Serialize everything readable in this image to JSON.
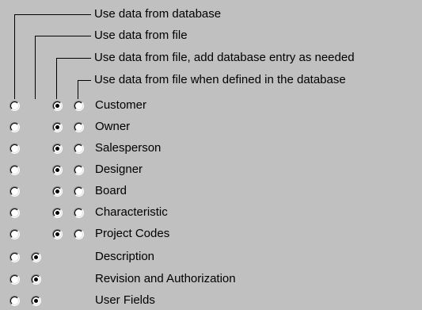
{
  "legend": [
    "Use data from database",
    "Use data from file",
    "Use data from file, add database entry as needed",
    "Use data from file when defined in the database"
  ],
  "rows": [
    {
      "label": "Customer",
      "options": [
        1,
        3,
        4
      ],
      "selected": 3
    },
    {
      "label": "Owner",
      "options": [
        1,
        3,
        4
      ],
      "selected": 3
    },
    {
      "label": "Salesperson",
      "options": [
        1,
        3,
        4
      ],
      "selected": 3
    },
    {
      "label": "Designer",
      "options": [
        1,
        3,
        4
      ],
      "selected": 3
    },
    {
      "label": "Board",
      "options": [
        1,
        3,
        4
      ],
      "selected": 3
    },
    {
      "label": "Characteristic",
      "options": [
        1,
        3,
        4
      ],
      "selected": 3
    },
    {
      "label": "Project Codes",
      "options": [
        1,
        3,
        4
      ],
      "selected": 3
    },
    {
      "label": "Description",
      "options": [
        1,
        2
      ],
      "selected": 2
    },
    {
      "label": "Revision and Authorization",
      "options": [
        1,
        2
      ],
      "selected": 2
    },
    {
      "label": "User Fields",
      "options": [
        1,
        2
      ],
      "selected": 2
    }
  ]
}
